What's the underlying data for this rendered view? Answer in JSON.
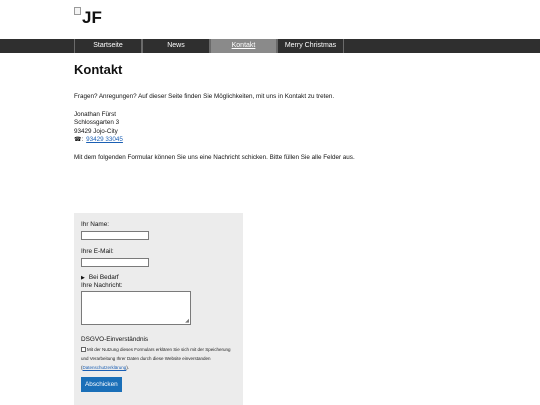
{
  "header": {
    "logo_text": "JF"
  },
  "nav": {
    "items": [
      {
        "label": "Startseite"
      },
      {
        "label": "News"
      },
      {
        "label": "Kontakt"
      },
      {
        "label": "Merry Christmas"
      }
    ]
  },
  "page": {
    "title": "Kontakt",
    "intro": "Fragen? Anregungen? Auf dieser Seite finden Sie Möglichkeiten, mit uns in Kontakt zu treten.",
    "address": {
      "name": "Jonathan Fürst",
      "street": "Schlossgarten 3",
      "city": "93429 Jojo-City",
      "phone_icon": "☎:",
      "phone": "93429 33045"
    },
    "form_intro": "Mit dem folgenden Formular können Sie uns eine Nachricht schicken. Bitte füllen Sie alle Felder aus."
  },
  "form": {
    "name_label": "Ihr Name:",
    "email_label": "Ihre E-Mail:",
    "details_label": "Bei Bedarf",
    "message_label": "Ihre Nachricht:",
    "consent_heading": "DSGVO-Einverständnis",
    "consent_text_1": "Mit der Nutzung dieses Formulars erklären Sie sich mit der Speicherung und Verarbeitung Ihrer Daten durch diese Website einverstanden (",
    "consent_link": "Datenschutzerklärung",
    "consent_text_2": ").",
    "submit_label": "Abschicken"
  }
}
